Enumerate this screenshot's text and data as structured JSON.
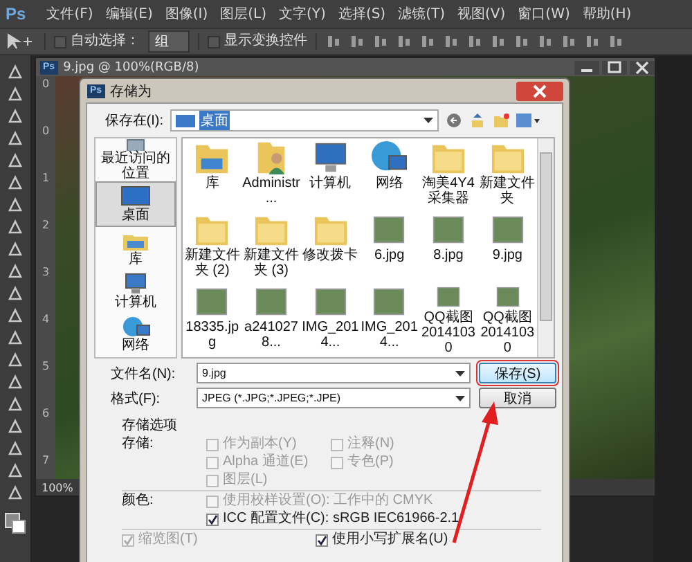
{
  "app": {
    "logo": "Ps",
    "menu": [
      "文件(F)",
      "编辑(E)",
      "图像(I)",
      "图层(L)",
      "文字(Y)",
      "选择(S)",
      "滤镜(T)",
      "视图(V)",
      "窗口(W)",
      "帮助(H)"
    ]
  },
  "options_bar": {
    "auto_select": {
      "label": "自动选择：",
      "checked": false
    },
    "group_select": "组",
    "transform_controls": {
      "label": "显示变换控件",
      "checked": false
    }
  },
  "document": {
    "icon": "Ps",
    "title": "9.jpg @ 100%(RGB/8)",
    "top_ruler": "0",
    "side_ruler": [
      "0",
      "1",
      "2",
      "3",
      "4",
      "5",
      "6",
      "7"
    ],
    "zoom": "100%"
  },
  "dialog": {
    "icon": "Ps",
    "title": "存储为",
    "save_in_label": "保存在(I):",
    "location": "桌面",
    "places": [
      {
        "label": "最近访问的位置",
        "kind": "recent",
        "selected": false
      },
      {
        "label": "桌面",
        "kind": "desktop",
        "selected": true
      },
      {
        "label": "库",
        "kind": "library",
        "selected": false
      },
      {
        "label": "计算机",
        "kind": "computer",
        "selected": false
      },
      {
        "label": "网络",
        "kind": "network",
        "selected": false
      }
    ],
    "files": [
      {
        "name": "库",
        "kind": "library"
      },
      {
        "name": "Administr...",
        "kind": "user"
      },
      {
        "name": "计算机",
        "kind": "computer"
      },
      {
        "name": "网络",
        "kind": "network"
      },
      {
        "name": "淘美4Y4采集器",
        "kind": "folder"
      },
      {
        "name": "新建文件夹",
        "kind": "folder"
      },
      {
        "name": "新建文件夹 (2)",
        "kind": "folder"
      },
      {
        "name": "新建文件夹 (3)",
        "kind": "folder"
      },
      {
        "name": "修改拨卡",
        "kind": "folder"
      },
      {
        "name": "6.jpg",
        "kind": "image"
      },
      {
        "name": "8.jpg",
        "kind": "image"
      },
      {
        "name": "9.jpg",
        "kind": "image"
      },
      {
        "name": "18335.jpg",
        "kind": "image"
      },
      {
        "name": "a2410278...",
        "kind": "image"
      },
      {
        "name": "IMG_2014...",
        "kind": "image"
      },
      {
        "name": "IMG_2014...",
        "kind": "image"
      },
      {
        "name": "QQ截图 20141030",
        "kind": "image"
      },
      {
        "name": "QQ截图 20141030",
        "kind": "image"
      }
    ],
    "filename_label": "文件名(N):",
    "filename": "9.jpg",
    "format_label": "格式(F):",
    "format": "JPEG (*.JPG;*.JPEG;*.JPE)",
    "buttons": [
      {
        "label": "保存(S)",
        "default": true,
        "annotated": true
      },
      {
        "label": "取消",
        "default": false,
        "annotated": false
      }
    ],
    "save_options": {
      "title": "存储选项",
      "store_label": "存储:",
      "items": [
        {
          "label": "作为副本(Y)",
          "checked": false,
          "disabled": true
        },
        {
          "label": "注释(N)",
          "checked": false,
          "disabled": true
        },
        {
          "label": "Alpha 通道(E)",
          "checked": false,
          "disabled": true
        },
        {
          "label": "专色(P)",
          "checked": false,
          "disabled": true
        },
        {
          "label": "图层(L)",
          "checked": false,
          "disabled": true
        }
      ],
      "color_label": "颜色:",
      "color_items": [
        {
          "label": "使用校样设置(O):  工作中的 CMYK",
          "checked": false,
          "disabled": true
        },
        {
          "label": "ICC 配置文件(C):  sRGB IEC61966-2.1",
          "checked": true,
          "disabled": false
        }
      ],
      "bottom_items": [
        {
          "label": "缩览图(T)",
          "checked": true,
          "disabled": true
        },
        {
          "label": "使用小写扩展名(U)",
          "checked": true,
          "disabled": false
        }
      ]
    }
  }
}
